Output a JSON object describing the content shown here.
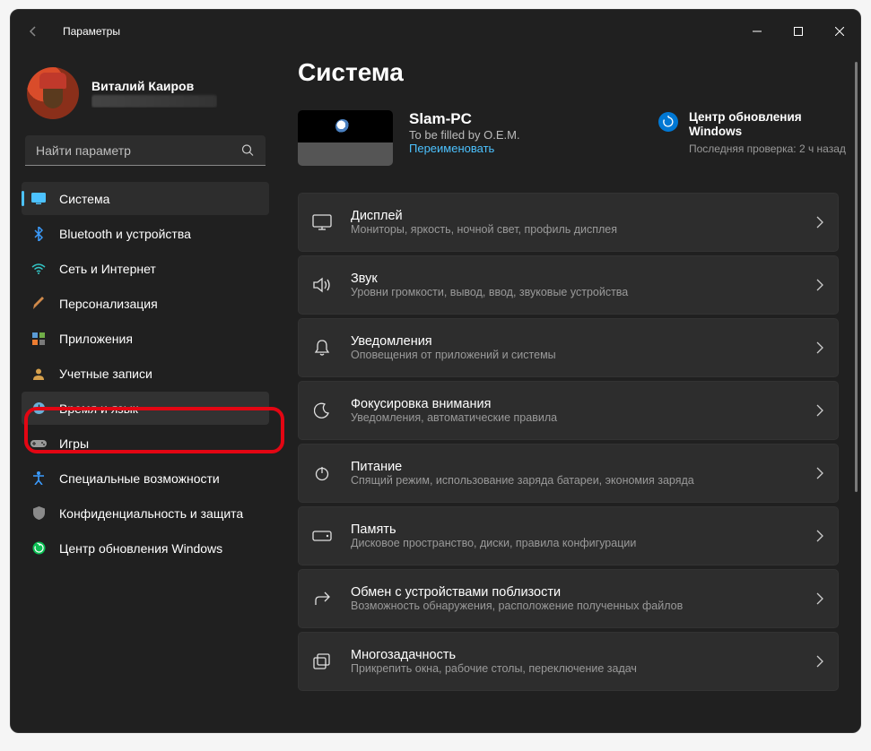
{
  "window": {
    "title": "Параметры"
  },
  "profile": {
    "name": "Виталий Каиров"
  },
  "search": {
    "placeholder": "Найти параметр"
  },
  "sidebar": [
    {
      "key": "system",
      "label": "Система",
      "icon": "monitor",
      "color": "#4cc2ff"
    },
    {
      "key": "bluetooth",
      "label": "Bluetooth и устройства",
      "icon": "bluetooth",
      "color": "#3b9cff"
    },
    {
      "key": "network",
      "label": "Сеть и Интернет",
      "icon": "wifi",
      "color": "#33c6c6"
    },
    {
      "key": "personalization",
      "label": "Персонализация",
      "icon": "brush",
      "color": "#d08a4a"
    },
    {
      "key": "apps",
      "label": "Приложения",
      "icon": "apps",
      "color": "#8a6fc7"
    },
    {
      "key": "accounts",
      "label": "Учетные записи",
      "icon": "user",
      "color": "#d6a04c"
    },
    {
      "key": "time",
      "label": "Время и язык",
      "icon": "clock",
      "color": "#6ab0d8"
    },
    {
      "key": "gaming",
      "label": "Игры",
      "icon": "gamepad",
      "color": "#9a9a9a"
    },
    {
      "key": "accessibility",
      "label": "Специальные возможности",
      "icon": "accessibility",
      "color": "#3b9cff"
    },
    {
      "key": "privacy",
      "label": "Конфиденциальность и защита",
      "icon": "shield",
      "color": "#8a8a8a"
    },
    {
      "key": "update",
      "label": "Центр обновления Windows",
      "icon": "refresh",
      "color": "#0abf53"
    }
  ],
  "page": {
    "title": "Система"
  },
  "pc": {
    "name": "Slam-PC",
    "sub": "To be filled by O.E.M.",
    "rename": "Переименовать"
  },
  "update": {
    "title": "Центр обновления Windows",
    "sub": "Последняя проверка: 2 ч назад"
  },
  "settings": [
    {
      "key": "display",
      "icon": "display",
      "title": "Дисплей",
      "sub": "Мониторы, яркость, ночной свет, профиль дисплея"
    },
    {
      "key": "sound",
      "icon": "sound",
      "title": "Звук",
      "sub": "Уровни громкости, вывод, ввод, звуковые устройства"
    },
    {
      "key": "notifications",
      "icon": "bell",
      "title": "Уведомления",
      "sub": "Оповещения от приложений и системы"
    },
    {
      "key": "focus",
      "icon": "moon",
      "title": "Фокусировка внимания",
      "sub": "Уведомления, автоматические правила"
    },
    {
      "key": "power",
      "icon": "power",
      "title": "Питание",
      "sub": "Спящий режим, использование заряда батареи, экономия заряда"
    },
    {
      "key": "storage",
      "icon": "drive",
      "title": "Память",
      "sub": "Дисковое пространство, диски, правила конфигурации"
    },
    {
      "key": "share",
      "icon": "share",
      "title": "Обмен с устройствами поблизости",
      "sub": "Возможность обнаружения, расположение полученных файлов"
    },
    {
      "key": "multitasking",
      "icon": "multitask",
      "title": "Многозадачность",
      "sub": "Прикрепить окна, рабочие столы, переключение задач"
    }
  ]
}
